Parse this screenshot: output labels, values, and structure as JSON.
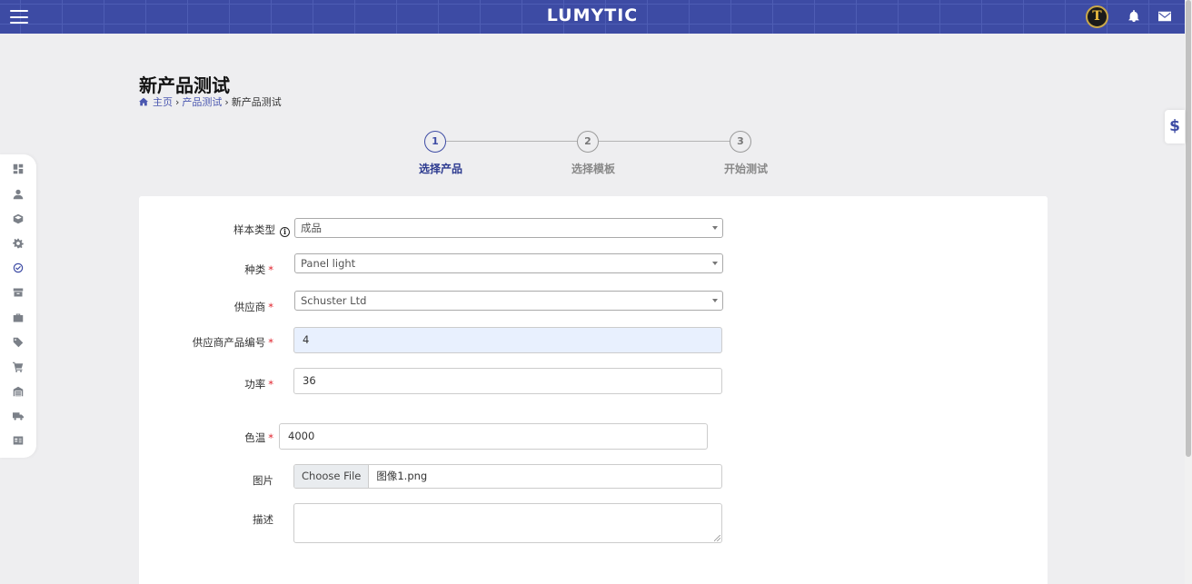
{
  "header": {
    "logo_text": "LUMYTIC",
    "avatar_initial": "T"
  },
  "page": {
    "title": "新产品测试",
    "breadcrumb": [
      {
        "label": "主页"
      },
      {
        "label": "产品测试"
      },
      {
        "label": "新产品测试"
      }
    ],
    "breadcrumb_sep": "›"
  },
  "floating_tab": {
    "symbol": "$"
  },
  "stepper": {
    "steps": [
      {
        "number": "1",
        "label": "选择产品",
        "active": true
      },
      {
        "number": "2",
        "label": "选择模板",
        "active": false
      },
      {
        "number": "3",
        "label": "开始测试",
        "active": false
      }
    ]
  },
  "form": {
    "sample_type": {
      "label": "样本类型",
      "value": "成品",
      "info_icon": "i"
    },
    "category": {
      "label": "种类",
      "value": "Panel light",
      "required": "*"
    },
    "supplier": {
      "label": "供应商",
      "value": "Schuster Ltd",
      "required": "*"
    },
    "supplier_product_no": {
      "label": "供应商产品编号",
      "value": "4",
      "required": "*"
    },
    "power": {
      "label": "功率",
      "value": "36",
      "required": "*"
    },
    "color_temp": {
      "label": "色温",
      "value": "4000",
      "required": "*"
    },
    "image": {
      "label": "图片",
      "button_label": "Choose File",
      "file_name": "图像1.png"
    },
    "description": {
      "label": "描述",
      "value": ""
    }
  },
  "colors": {
    "primary": "#3d4ba4",
    "background": "#eeeef0",
    "required": "#e0202a",
    "autofill": "#e8f0fe"
  },
  "sidebar": {
    "items": [
      {
        "icon": "dashboard-icon"
      },
      {
        "icon": "user-icon"
      },
      {
        "icon": "box-icon"
      },
      {
        "icon": "gear-icon"
      },
      {
        "icon": "check-circle-icon",
        "active": true
      },
      {
        "icon": "archive-icon"
      },
      {
        "icon": "briefcase-icon"
      },
      {
        "icon": "tag-icon"
      },
      {
        "icon": "cart-icon"
      },
      {
        "icon": "warehouse-icon"
      },
      {
        "icon": "truck-icon"
      },
      {
        "icon": "id-card-icon"
      }
    ]
  }
}
